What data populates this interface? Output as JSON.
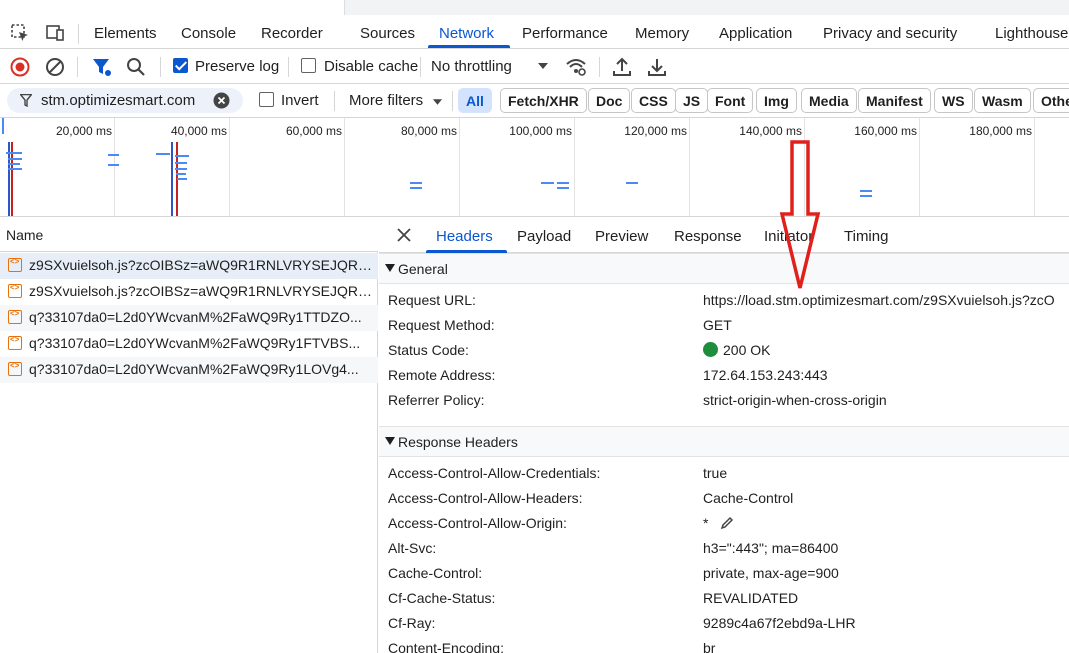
{
  "tabs": [
    {
      "label": "Elements"
    },
    {
      "label": "Console"
    },
    {
      "label": "Recorder"
    },
    {
      "label": "Sources"
    },
    {
      "label": "Network"
    },
    {
      "label": "Performance"
    },
    {
      "label": "Memory"
    },
    {
      "label": "Application"
    },
    {
      "label": "Privacy and security"
    },
    {
      "label": "Lighthouse"
    }
  ],
  "active_tab": "Network",
  "toolbar": {
    "preserve_log_label": "Preserve log",
    "preserve_log_checked": true,
    "disable_cache_label": "Disable cache",
    "disable_cache_checked": false,
    "throttling_label": "No throttling"
  },
  "filter": {
    "value": "stm.optimizesmart.com",
    "invert_label": "Invert",
    "more_filters_label": "More filters",
    "types": [
      "All",
      "Fetch/XHR",
      "Doc",
      "CSS",
      "JS",
      "Font",
      "Img",
      "Media",
      "Manifest",
      "WS",
      "Wasm",
      "Othe"
    ],
    "active_type": "All"
  },
  "overview": {
    "ticks": [
      "20,000 ms",
      "40,000 ms",
      "60,000 ms",
      "80,000 ms",
      "100,000 ms",
      "120,000 ms",
      "140,000 ms",
      "160,000 ms",
      "180,000 ms"
    ]
  },
  "requests": {
    "column_name": "Name",
    "rows": [
      "z9SXvuielsoh.js?zcOIBSz=aWQ9R1RNLVRYSEJQRA...",
      "z9SXvuielsoh.js?zcOIBSz=aWQ9R1RNLVRYSEJQRA...",
      "q?33107da0=L2d0YWcvanM%2FaWQ9Ry1TTDZO...",
      "q?33107da0=L2d0YWcvanM%2FaWQ9Ry1FTVBS...",
      "q?33107da0=L2d0YWcvanM%2FaWQ9Ry1LOVg4..."
    ]
  },
  "details": {
    "tabs": [
      "Headers",
      "Payload",
      "Preview",
      "Response",
      "Initiator",
      "Timing"
    ],
    "active_tab": "Headers",
    "general_title": "General",
    "general": [
      {
        "k": "Request URL:",
        "v": "https://load.stm.optimizesmart.com/z9SXvuielsoh.js?zcO"
      },
      {
        "k": "Request Method:",
        "v": "GET"
      },
      {
        "k": "Status Code:",
        "v": "200 OK"
      },
      {
        "k": "Remote Address:",
        "v": "172.64.153.243:443"
      },
      {
        "k": "Referrer Policy:",
        "v": "strict-origin-when-cross-origin"
      }
    ],
    "response_title": "Response Headers",
    "response": [
      {
        "k": "Access-Control-Allow-Credentials:",
        "v": "true"
      },
      {
        "k": "Access-Control-Allow-Headers:",
        "v": "Cache-Control"
      },
      {
        "k": "Access-Control-Allow-Origin:",
        "v": "*"
      },
      {
        "k": "Alt-Svc:",
        "v": "h3=\":443\"; ma=86400"
      },
      {
        "k": "Cache-Control:",
        "v": "private, max-age=900"
      },
      {
        "k": "Cf-Cache-Status:",
        "v": "REVALIDATED"
      },
      {
        "k": "Cf-Ray:",
        "v": "9289c4a67f2ebd9a-LHR"
      },
      {
        "k": "Content-Encoding:",
        "v": "br"
      }
    ]
  },
  "colors": {
    "accent": "#0b57d0",
    "status_ok": "#1e8e3e",
    "annotation_arrow": "#e0201b"
  }
}
